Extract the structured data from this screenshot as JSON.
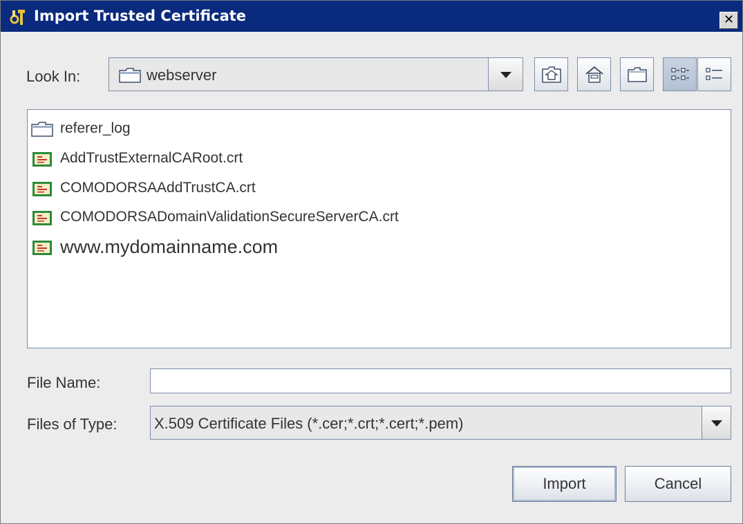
{
  "window": {
    "title": "Import Trusted Certificate",
    "close_glyph": "✕"
  },
  "look_in": {
    "label": "Look In:",
    "value": "webserver",
    "icon": "folder-icon"
  },
  "toolbar": {
    "buttons": [
      {
        "name": "up-one-level-button",
        "icon": "up-folder-icon"
      },
      {
        "name": "home-button",
        "icon": "home-icon"
      },
      {
        "name": "new-folder-button",
        "icon": "new-folder-icon"
      },
      {
        "name": "list-view-button",
        "icon": "list-view-icon",
        "toggled": true
      },
      {
        "name": "details-view-button",
        "icon": "details-view-icon",
        "toggled": false
      }
    ]
  },
  "files": [
    {
      "label": "referer_log",
      "type": "folder"
    },
    {
      "label": "AddTrustExternalCARoot.crt",
      "type": "certificate"
    },
    {
      "label": "COMODORSAAddTrustCA.crt",
      "type": "certificate"
    },
    {
      "label": "COMODORSADomainValidationSecureServerCA.crt",
      "type": "certificate"
    },
    {
      "label": "www.mydomainname.com",
      "type": "certificate"
    }
  ],
  "file_name": {
    "label": "File Name:",
    "value": ""
  },
  "files_of_type": {
    "label": "Files of Type:",
    "value": "X.509 Certificate Files (*.cer;*.crt;*.cert;*.pem)"
  },
  "actions": {
    "import_label": "Import",
    "cancel_label": "Cancel"
  },
  "colors": {
    "titlebar": "#0a2a7e",
    "dialog_bg": "#ececec",
    "border": "#7b8da6"
  }
}
